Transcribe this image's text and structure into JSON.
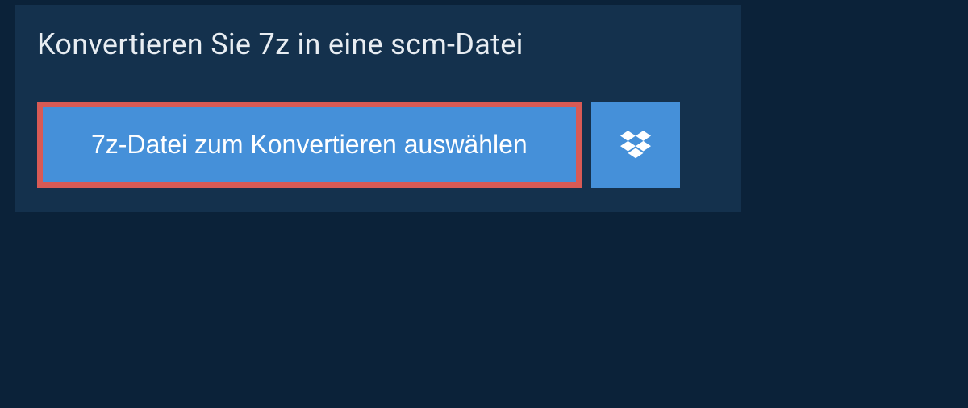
{
  "header": {
    "title": "Konvertieren Sie 7z in eine scm-Datei"
  },
  "actions": {
    "select_file_label": "7z-Datei zum Konvertieren auswählen"
  },
  "colors": {
    "page_bg": "#0b2239",
    "panel_bg": "#14314d",
    "button_bg": "#4590d9",
    "highlight_border": "#d85a55"
  }
}
